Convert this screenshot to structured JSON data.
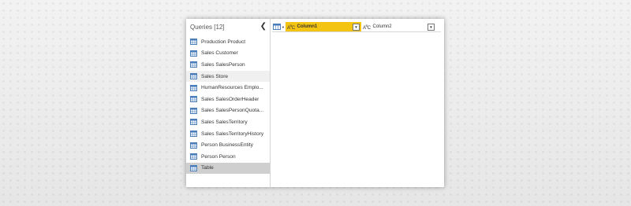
{
  "queries_pane": {
    "title": "Queries [12]",
    "collapse_icon": "chevron-left-icon",
    "items": [
      {
        "label": "Production Product"
      },
      {
        "label": "Sales Customer"
      },
      {
        "label": "Sales SalesPerson"
      },
      {
        "label": "Sales Store"
      },
      {
        "label": "HumanResources Emplo..."
      },
      {
        "label": "Sales SalesOrderHeader"
      },
      {
        "label": "Sales SalesPersonQuota..."
      },
      {
        "label": "Sales SalesTerritory"
      },
      {
        "label": "Sales SalesTerritoryHistory"
      },
      {
        "label": "Person BusinessEntity"
      },
      {
        "label": "Person Person"
      },
      {
        "label": "Table"
      }
    ],
    "hover_index": 3,
    "selected_index": 11
  },
  "grid": {
    "columns": [
      {
        "name": "Column1",
        "type_icon": "abc-text-type-icon",
        "selected": true
      },
      {
        "name": "Column2",
        "type_icon": "abc-text-type-icon",
        "selected": false
      }
    ]
  },
  "colors": {
    "selected_column": "#f3c411",
    "selected_query": "#cfcfcf",
    "table_icon": "#4a7ebb"
  }
}
